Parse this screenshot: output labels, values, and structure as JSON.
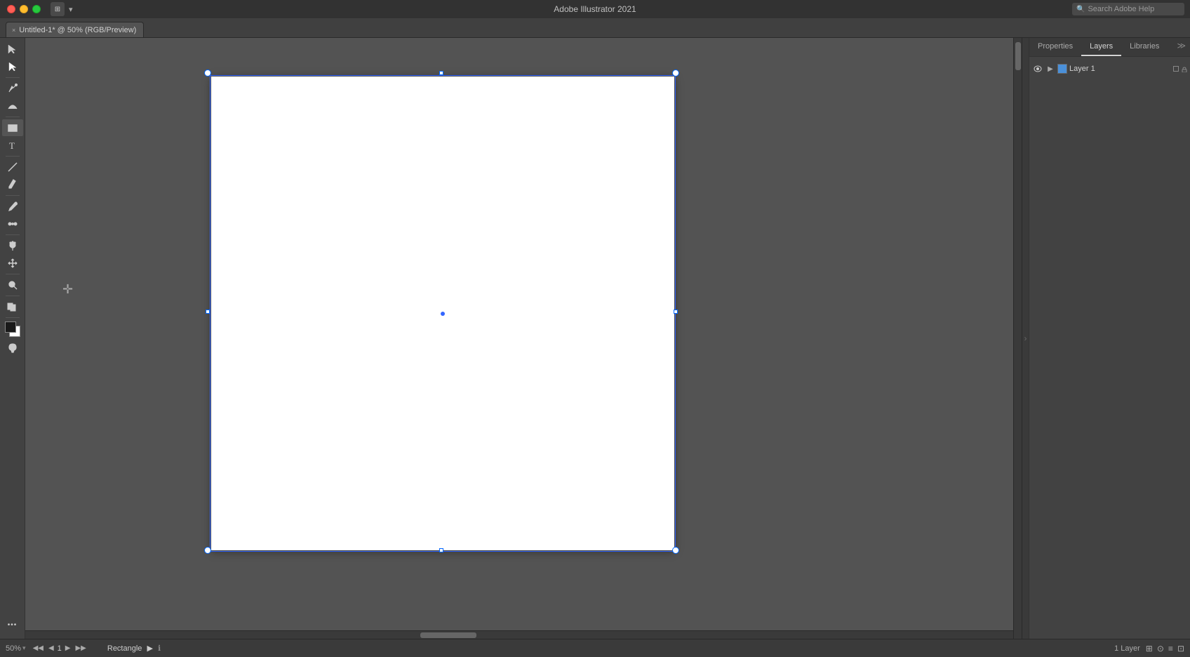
{
  "titlebar": {
    "app_title": "Adobe Illustrator 2021",
    "search_placeholder": "Search Adobe Help",
    "traffic_lights": [
      "close",
      "minimize",
      "maximize"
    ]
  },
  "tabbar": {
    "active_tab": {
      "close_symbol": "×",
      "label": "Untitled-1* @ 50% (RGB/Preview)"
    }
  },
  "toolbar": {
    "tools": [
      {
        "name": "selection-tool",
        "symbol": "↖",
        "title": "Selection Tool (V)"
      },
      {
        "name": "direct-selection-tool",
        "symbol": "↗",
        "title": "Direct Selection Tool (A)"
      },
      {
        "name": "pen-tool",
        "symbol": "✒",
        "title": "Pen Tool (P)"
      },
      {
        "name": "curvature-tool",
        "symbol": "∫",
        "title": "Curvature Tool (~)"
      },
      {
        "name": "rectangle-tool",
        "symbol": "▭",
        "title": "Rectangle Tool (M)",
        "active": true
      },
      {
        "name": "type-tool",
        "symbol": "T",
        "title": "Type Tool (T)"
      },
      {
        "name": "arc-tool",
        "symbol": "◜",
        "title": "Arc Tool"
      },
      {
        "name": "eraser-tool",
        "symbol": "◇",
        "title": "Eraser Tool (Shift+E)"
      },
      {
        "name": "lasso-tool",
        "symbol": "⌾",
        "title": "Lasso Tool (Q)"
      },
      {
        "name": "artboard-tool",
        "symbol": "⬜",
        "title": "Artboard Tool (Shift+O)"
      },
      {
        "name": "line-tool",
        "symbol": "╱",
        "title": "Line Segment Tool (\\)"
      },
      {
        "name": "eyedropper-tool",
        "symbol": "✕",
        "title": "Eyedropper Tool (I)"
      },
      {
        "name": "blend-tool",
        "symbol": "∞",
        "title": "Blend Tool (W)"
      },
      {
        "name": "symbol-sprayer",
        "symbol": "⊛",
        "title": "Symbol Sprayer Tool (Shift+S)"
      },
      {
        "name": "move-tool",
        "symbol": "⊕",
        "title": "Move Tool"
      },
      {
        "name": "zoom-tool",
        "symbol": "⊙",
        "title": "Zoom Tool (Z)"
      },
      {
        "name": "linked-files",
        "symbol": "⊞",
        "title": "Linked Files"
      },
      {
        "name": "color-guide",
        "symbol": "⊠",
        "title": "Color Guide"
      },
      {
        "name": "more-tools",
        "symbol": "···",
        "title": "More Tools"
      }
    ]
  },
  "canvas": {
    "artboard_label": "Rectangle",
    "center_dot": true
  },
  "right_panel": {
    "tabs": [
      {
        "id": "properties",
        "label": "Properties"
      },
      {
        "id": "layers",
        "label": "Layers",
        "active": true
      },
      {
        "id": "libraries",
        "label": "Libraries"
      }
    ],
    "layers": [
      {
        "name": "Layer 1",
        "color": "#4a90d9",
        "visible": true,
        "expanded": true,
        "locked": false
      }
    ]
  },
  "statusbar": {
    "zoom": "50%",
    "page": "1",
    "tool_label": "Rectangle",
    "layers_count": "1 Layer",
    "nav_prev_symbol": "◀",
    "nav_next_symbol": "▶",
    "nav_first_symbol": "◀◀",
    "nav_last_symbol": "▶▶"
  }
}
